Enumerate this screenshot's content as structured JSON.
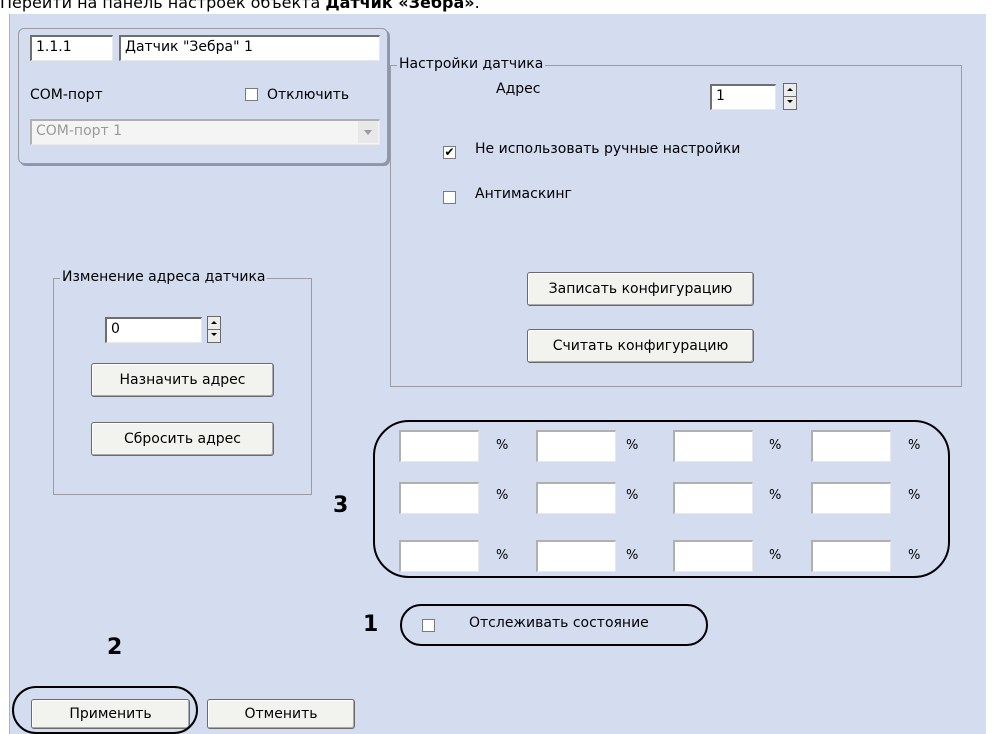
{
  "caption": {
    "prefix": "Перейти на панель настроек объекта ",
    "object": "Датчик «Зебра»",
    "suffix": "."
  },
  "object_box": {
    "id_value": "1.1.1",
    "name_value": "Датчик \"Зебра\" 1",
    "com_port_label": "COM-порт",
    "disable_label": "Отключить",
    "disable_checked": false,
    "com_port_select": "COM-порт 1"
  },
  "sensor_settings": {
    "legend": "Настройки датчика",
    "address_label": "Адрес",
    "address_value": "1",
    "manual_label": "Не использовать ручные настройки",
    "manual_checked": true,
    "check_mark": "✔",
    "antimasking_label": "Антимаскинг",
    "antimasking_checked": false,
    "write_button": "Записать конфигурацию",
    "read_button": "Считать конфигурацию"
  },
  "change_address": {
    "legend": "Изменение адреса датчика",
    "value": "0",
    "assign_button": "Назначить адрес",
    "reset_button": "Сбросить адрес"
  },
  "percent_grid": {
    "unit": "%",
    "cells": [
      "",
      "",
      "",
      "",
      "",
      "",
      "",
      "",
      "",
      "",
      "",
      ""
    ]
  },
  "track_state": {
    "label": "Отслеживать состояние",
    "checked": false
  },
  "footer": {
    "apply_button": "Применить",
    "cancel_button": "Отменить"
  },
  "annotations": {
    "n1": "1",
    "n2": "2",
    "n3": "3"
  }
}
